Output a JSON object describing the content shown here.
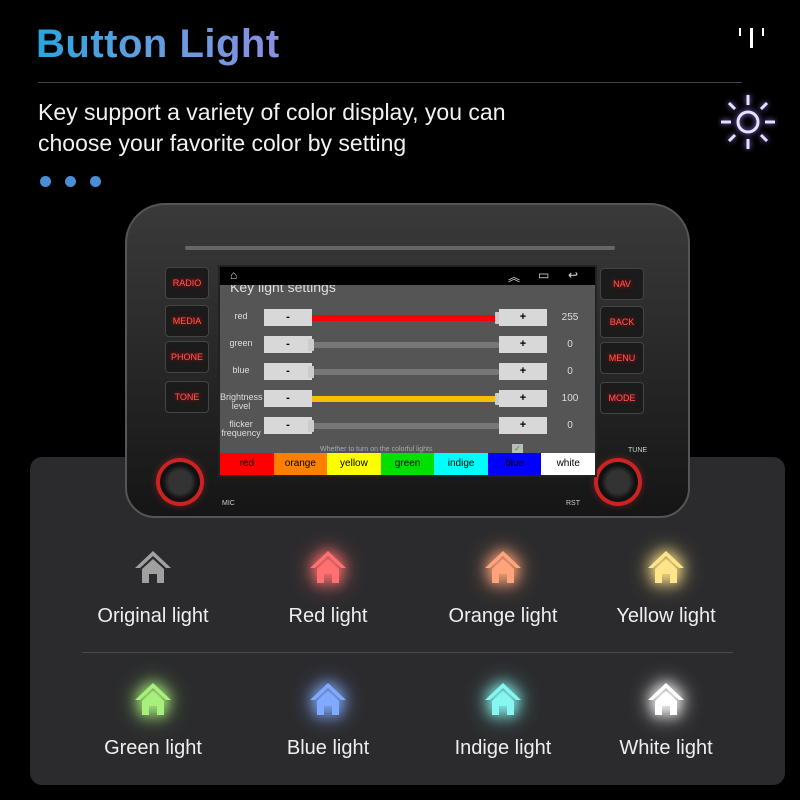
{
  "header": {
    "title": "Button Light",
    "description_line1": "Key support a variety of color display, you can",
    "description_line2": "choose your favorite color by setting",
    "icons": [
      "bars-icon",
      "sun-icon"
    ]
  },
  "device": {
    "left_buttons": [
      "RADIO",
      "MEDIA",
      "PHONE",
      "TONE"
    ],
    "right_buttons": [
      "NAV",
      "BACK",
      "MENU",
      "MODE"
    ],
    "labels": {
      "mic": "MIC",
      "rst": "RST",
      "tune": "TUNE"
    },
    "screen": {
      "title": "Key light settings",
      "minus": "-",
      "plus": "+",
      "rows": [
        {
          "label": "red",
          "value": "255",
          "fraction": 1.0,
          "fill_color": "#ff0000"
        },
        {
          "label": "green",
          "value": "0",
          "fraction": 0
        },
        {
          "label": "blue",
          "value": "0",
          "fraction": 0
        },
        {
          "label": "Brightness level",
          "value": "100",
          "fraction": 1.0,
          "fill_color": "#f5c000"
        },
        {
          "label": "flicker frequency",
          "value": "0",
          "fraction": 0
        }
      ],
      "colorful_text": "Whether to turn on the colorful lights",
      "colorful_checked": true,
      "colors": [
        {
          "label": "red",
          "bg": "#ff0000"
        },
        {
          "label": "orange",
          "bg": "#ff8000"
        },
        {
          "label": "yellow",
          "bg": "#ffff00"
        },
        {
          "label": "green",
          "bg": "#00e000"
        },
        {
          "label": "indige",
          "bg": "#00ffff"
        },
        {
          "label": "blue",
          "bg": "#0000ff"
        },
        {
          "label": "white",
          "bg": "#ffffff"
        }
      ]
    }
  },
  "lights": [
    {
      "label": "Original light",
      "color": "#a0a0a0"
    },
    {
      "label": "Red light",
      "color": "#ff7070"
    },
    {
      "label": "Orange light",
      "color": "#ffa47a"
    },
    {
      "label": "Yellow light",
      "color": "#ffe48a"
    },
    {
      "label": "Green light",
      "color": "#a8f07c"
    },
    {
      "label": "Blue light",
      "color": "#80aaff"
    },
    {
      "label": "Indige light",
      "color": "#86f6f0"
    },
    {
      "label": "White light",
      "color": "#ffffff"
    }
  ]
}
